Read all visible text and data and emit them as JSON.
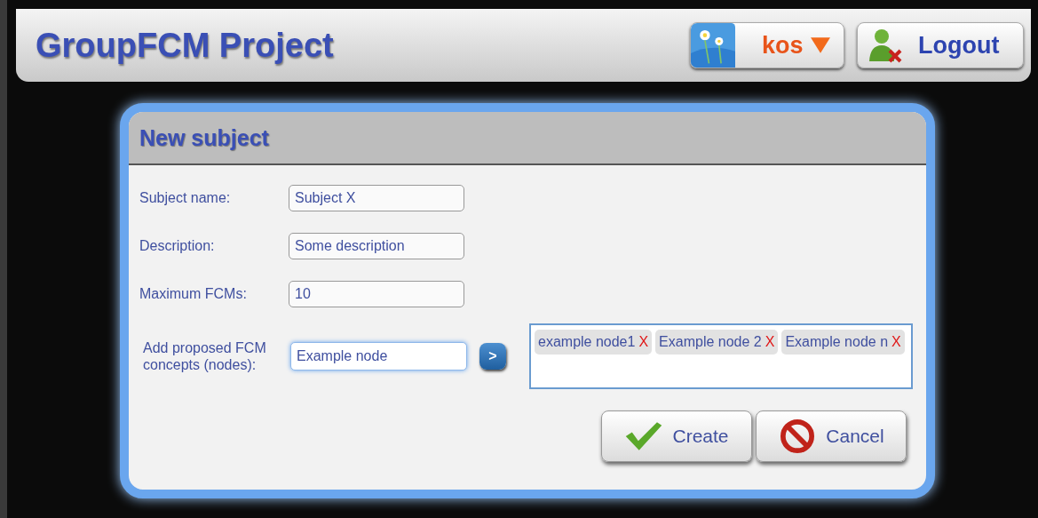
{
  "header": {
    "title": "GroupFCM Project",
    "user_menu": {
      "label": "kos"
    },
    "logout": {
      "label": "Logout"
    }
  },
  "dialog": {
    "title": "New subject",
    "fields": [
      {
        "label": "Subject name:",
        "value": "Subject X"
      },
      {
        "label": "Description:",
        "value": "Some description"
      },
      {
        "label": "Maximum FCMs:",
        "value": "10"
      }
    ],
    "concepts": {
      "label": "Add proposed FCM concepts (nodes):",
      "value": "Example node",
      "focused": true,
      "add_button": ">",
      "tags": [
        {
          "label": "example node1",
          "remove": "X"
        },
        {
          "label": "Example node 2",
          "remove": "X"
        },
        {
          "label": "Example node n",
          "remove": "X"
        }
      ]
    },
    "buttons": [
      {
        "kind": "create",
        "label": "Create"
      },
      {
        "kind": "cancel",
        "label": "Cancel"
      }
    ]
  }
}
